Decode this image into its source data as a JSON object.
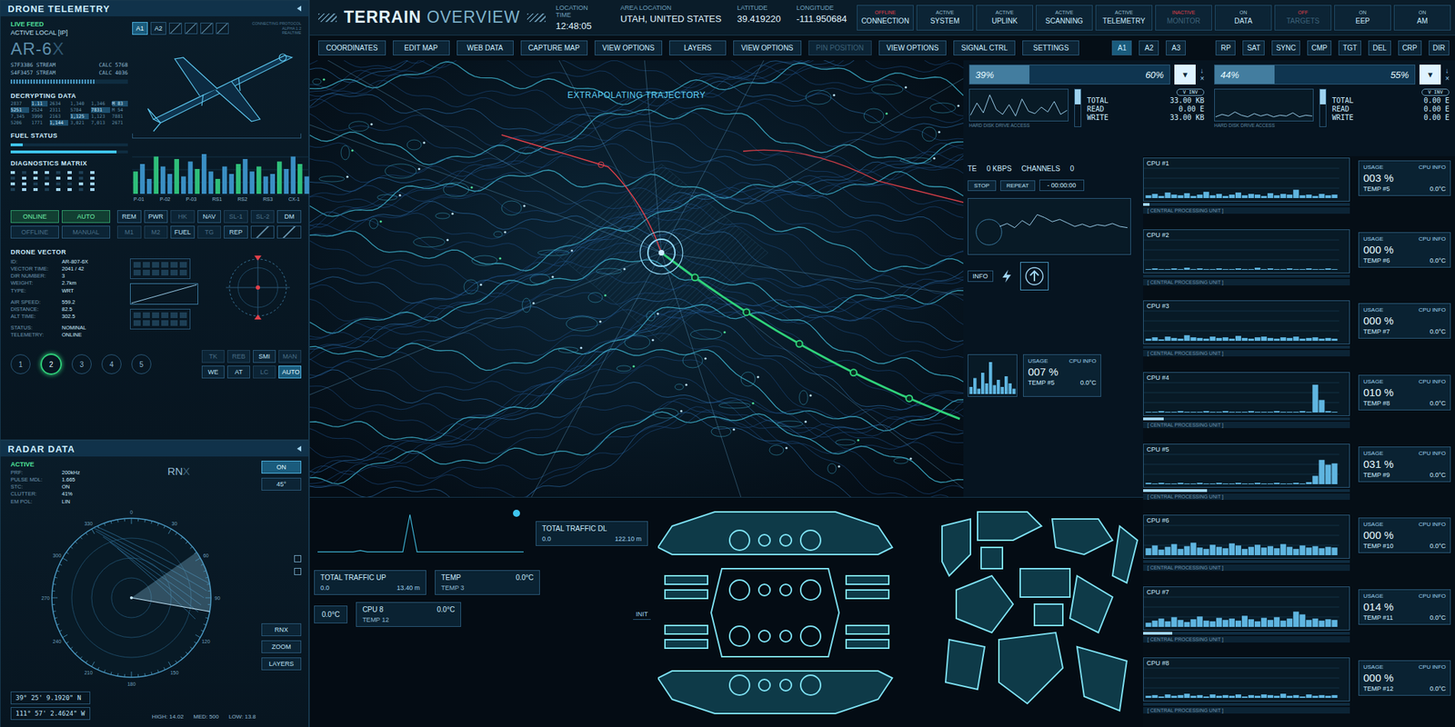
{
  "header": {
    "title_bold": "TERRAIN",
    "title_light": "OVERVIEW",
    "fields": [
      {
        "label": "LOCATION TIME",
        "value": "12:48:05"
      },
      {
        "label": "AREA LOCATION",
        "value": "UTAH, UNITED STATES"
      },
      {
        "label": "LATITUDE",
        "value": "39.419220"
      },
      {
        "label": "LONGITUDE",
        "value": "-111.950684"
      }
    ],
    "status": [
      {
        "state": "OFFLINE",
        "label": "CONNECTION",
        "on": false,
        "disabled": false
      },
      {
        "state": "ACTIVE",
        "label": "SYSTEM",
        "on": true,
        "disabled": false
      },
      {
        "state": "ACTIVE",
        "label": "UPLINK",
        "on": true,
        "disabled": false
      },
      {
        "state": "ACTIVE",
        "label": "SCANNING",
        "on": true,
        "disabled": false
      },
      {
        "state": "ACTIVE",
        "label": "TELEMETRY",
        "on": true,
        "disabled": false
      },
      {
        "state": "INACTIVE",
        "label": "MONITOR",
        "on": false,
        "disabled": true
      },
      {
        "state": "ON",
        "label": "DATA",
        "on": true,
        "disabled": false
      },
      {
        "state": "OFF",
        "label": "TARGETS",
        "on": false,
        "disabled": true
      },
      {
        "state": "ON",
        "label": "EEP",
        "on": true,
        "disabled": false
      },
      {
        "state": "ON",
        "label": "AM",
        "on": true,
        "disabled": false
      }
    ]
  },
  "toolbar": {
    "buttons": [
      {
        "label": "COORDINATES",
        "disabled": false
      },
      {
        "label": "EDIT MAP",
        "disabled": false
      },
      {
        "label": "WEB DATA",
        "disabled": false
      },
      {
        "label": "CAPTURE MAP",
        "disabled": false
      },
      {
        "label": "VIEW OPTIONS",
        "disabled": false
      },
      {
        "label": "LAYERS",
        "disabled": false
      },
      {
        "label": "VIEW OPTIONS",
        "disabled": false
      },
      {
        "label": "PIN POSITION",
        "disabled": true
      },
      {
        "label": "VIEW OPTIONS",
        "disabled": false
      },
      {
        "label": "SIGNAL CTRL",
        "disabled": false
      },
      {
        "label": "SETTINGS",
        "disabled": false
      }
    ],
    "tabs": [
      {
        "label": "A1",
        "selected": true
      },
      {
        "label": "A2",
        "selected": false
      },
      {
        "label": "A3",
        "selected": false
      }
    ],
    "tools": [
      "RP",
      "SAT",
      "SYNC",
      "CMP",
      "TGT",
      "DEL",
      "CRP",
      "DIR"
    ]
  },
  "telemetry": {
    "title": "DRONE TELEMETRY",
    "feed": "LIVE FEED",
    "source": "ACTIVE LOCAL [IP]",
    "model_bold": "AR-6",
    "model_light": "X",
    "protocol": [
      "CONNECTING PROTOCOL",
      "ALPHA 1.2",
      "REALTIME"
    ],
    "tabs": [
      {
        "label": "A1",
        "selected": true
      },
      {
        "label": "A2",
        "selected": false
      }
    ],
    "streams": [
      {
        "name": "S7F3386 STREAM",
        "calc": "CALC 5768"
      },
      {
        "name": "S4F3457 STREAM",
        "calc": "CALC 4036"
      }
    ],
    "stream_level": 0.72,
    "decrypt": {
      "title": "DECRYPTING DATA",
      "rows": [
        [
          "2837",
          "1.11",
          "2634",
          "1,340",
          "1,346",
          "M 83"
        ],
        [
          "5251",
          "2524",
          "2311",
          "5784",
          "7831",
          "M 54"
        ],
        [
          "7,345",
          "3990",
          "2163",
          "1,125",
          "1,123",
          "7881"
        ],
        [
          "5206",
          "1771",
          "1,144",
          "3,021",
          "7,013",
          "2671"
        ]
      ]
    },
    "fuel": {
      "title": "FUEL STATUS",
      "levels": [
        0.1,
        0.9
      ]
    },
    "diagnostics": {
      "title": "DIAGNOSTICS MATRIX",
      "cells": [
        true,
        false,
        true,
        true,
        false,
        true,
        false,
        true,
        false,
        true,
        true,
        false,
        true,
        true,
        false,
        true,
        true,
        true,
        false,
        true,
        false,
        false,
        true,
        true,
        false,
        true,
        true,
        false,
        true,
        true,
        false,
        true
      ],
      "labels": [
        "P-01",
        "P-02",
        "P-03",
        "RS1",
        "RS2",
        "RS3",
        "CX-1"
      ],
      "values": [
        45,
        60,
        30,
        75,
        55,
        40,
        70,
        35,
        65,
        50,
        80,
        45,
        30,
        55,
        40,
        60,
        70,
        45,
        55,
        35,
        40,
        65,
        50,
        75,
        60,
        35,
        45,
        55
      ]
    },
    "modes": [
      {
        "label": "ONLINE",
        "selected": true
      },
      {
        "label": "AUTO",
        "selected": true
      },
      {
        "label": "OFFLINE",
        "selected": false
      },
      {
        "label": "MANUAL",
        "selected": false
      }
    ],
    "keys": [
      {
        "label": "REM",
        "disabled": false
      },
      {
        "label": "PWR",
        "disabled": false
      },
      {
        "label": "HK",
        "disabled": true
      },
      {
        "label": "NAV",
        "disabled": false
      },
      {
        "label": "SL-1",
        "disabled": true
      },
      {
        "label": "SL-2",
        "disabled": true
      },
      {
        "label": "DM",
        "disabled": false
      },
      {
        "label": "M1",
        "disabled": true
      },
      {
        "label": "M2",
        "disabled": true
      },
      {
        "label": "FUEL",
        "disabled": false
      },
      {
        "label": "TG",
        "disabled": true
      },
      {
        "label": "REP",
        "disabled": false
      }
    ],
    "vector": {
      "title": "DRONE VECTOR",
      "groups": [
        [
          {
            "label": "ID:",
            "value": "AR-807-6X"
          },
          {
            "label": "VECTOR TIME:",
            "value": "2041 / 42"
          },
          {
            "label": "DIR NUMBER:",
            "value": "3"
          },
          {
            "label": "WEIGHT:",
            "value": "2.7km"
          },
          {
            "label": "TYPE:",
            "value": "WRT"
          }
        ],
        [
          {
            "label": "AIR SPEED:",
            "value": "559.2"
          },
          {
            "label": "DISTANCE:",
            "value": "82.5"
          },
          {
            "label": "ALT TIME:",
            "value": "302.5"
          }
        ],
        [
          {
            "label": "STATUS:",
            "value": "NOMINAL"
          },
          {
            "label": "TELEMETRY:",
            "value": "ONLINE"
          }
        ]
      ]
    },
    "slots": [
      {
        "label": "1",
        "selected": false
      },
      {
        "label": "2",
        "selected": true
      },
      {
        "label": "3",
        "selected": false
      },
      {
        "label": "4",
        "selected": false
      },
      {
        "label": "5",
        "selected": false
      }
    ],
    "switches": [
      {
        "label": "TK",
        "disabled": true,
        "selected": false
      },
      {
        "label": "REB",
        "disabled": true,
        "selected": false
      },
      {
        "label": "SMI",
        "disabled": false,
        "selected": false
      },
      {
        "label": "MAN",
        "disabled": true,
        "selected": false
      },
      {
        "label": "WE",
        "disabled": false,
        "selected": false
      },
      {
        "label": "AT",
        "disabled": false,
        "selected": false
      },
      {
        "label": "LC",
        "disabled": true,
        "selected": false
      },
      {
        "label": "AUTO",
        "disabled": false,
        "selected": true
      }
    ]
  },
  "radar": {
    "title": "RADAR DATA",
    "status": "ACTIVE",
    "name_bold": "RN",
    "name_light": "X",
    "toggle": "ON",
    "angle": "45°",
    "params": [
      {
        "label": "PRF:",
        "value": "200kHz"
      },
      {
        "label": "PULSE MDL:",
        "value": "1.665"
      },
      {
        "label": "STC:",
        "value": "ON"
      },
      {
        "label": "CLUTTER:",
        "value": "41%"
      },
      {
        "label": "EM POL:",
        "value": "LIN"
      }
    ],
    "bearings": [
      "0",
      "30",
      "60",
      "90",
      "120",
      "150",
      "180",
      "210",
      "240",
      "270",
      "300",
      "330"
    ],
    "coords": [
      "39° 25' 9.1920\" N",
      "111° 57' 2.4624\" W"
    ],
    "buttons": [
      "RNX",
      "ZOOM",
      "LAYERS"
    ],
    "readings": [
      {
        "label": "HIGH:",
        "value": "14.02"
      },
      {
        "label": "MED:",
        "value": "500"
      },
      {
        "label": "LOW:",
        "value": "13.8"
      }
    ]
  },
  "map": {
    "caption": "EXTRAPOLATING TRAJECTORY"
  },
  "disks": [
    {
      "low": "39%",
      "high": "60%",
      "level": 0.3,
      "arrow": "▼",
      "marks": [
        "↓",
        "×"
      ],
      "caption": "HARD DISK DRIVE ACCESS",
      "filter": "V INV",
      "stats": [
        {
          "label": "TOTAL",
          "value": "33.00 KB"
        },
        {
          "label": "READ",
          "value": "0.00 E"
        },
        {
          "label": "WRITE",
          "value": "33.00 KB"
        }
      ],
      "values": [
        5,
        20,
        8,
        30,
        12,
        6,
        18,
        4,
        25,
        10,
        7,
        15,
        9,
        22,
        6,
        11
      ]
    },
    {
      "low": "44%",
      "high": "55%",
      "level": 0.3,
      "arrow": "▼",
      "marks": [
        "↓",
        "×"
      ],
      "caption": "HARD DISK DRIVE ACCESS",
      "filter": "V INV",
      "stats": [
        {
          "label": "TOTAL",
          "value": "0.00 E"
        },
        {
          "label": "READ",
          "value": "0.00 E"
        },
        {
          "label": "WRITE",
          "value": "0.00 E"
        }
      ],
      "values": [
        3,
        6,
        4,
        9,
        5,
        3,
        7,
        4,
        6,
        3,
        5,
        4,
        8,
        3,
        5,
        4
      ]
    }
  ],
  "monitor": {
    "rate_label": "TE",
    "rate": "0 KBPS",
    "channels_label": "CHANNELS",
    "channels": "0",
    "controls": [
      "STOP",
      "REPEAT"
    ],
    "timer": "- 00:00:00",
    "info": "INFO",
    "values": [
      30,
      35,
      28,
      40,
      32,
      50,
      45,
      38,
      42,
      36,
      30,
      34,
      29,
      33,
      31,
      35,
      30,
      28
    ],
    "usage": {
      "label": "USAGE",
      "tag": "CPU INFO",
      "value": "007 %",
      "temp": "TEMP #5",
      "temp_value": "0.0°C",
      "values": [
        4,
        9,
        3,
        12,
        6,
        18,
        5,
        8,
        4,
        10,
        6,
        3
      ]
    }
  },
  "cpu_labels": {
    "usage": "USAGE",
    "tag": "CPU INFO"
  },
  "cpus": [
    {
      "name": "CPU #1",
      "caption": "[ CENTRAL PROCESSING UNIT ]",
      "usage": "003 %",
      "temp": "TEMP #5",
      "temp_value": "0.0°C",
      "level": 0.03,
      "values": [
        4,
        6,
        3,
        8,
        5,
        4,
        7,
        3,
        5,
        9,
        4,
        6,
        3,
        5,
        8,
        4,
        6,
        5,
        3,
        7,
        4,
        6,
        5,
        12,
        4,
        5,
        3,
        6,
        4,
        5
      ]
    },
    {
      "name": "CPU #2",
      "caption": "[ CENTRAL PROCESSING UNIT ]",
      "usage": "000 %",
      "temp": "TEMP #6",
      "temp_value": "0.0°C",
      "level": 0.0,
      "values": [
        1,
        2,
        1,
        1,
        2,
        1,
        3,
        1,
        2,
        1,
        1,
        2,
        1,
        1,
        2,
        1,
        1,
        3,
        1,
        2,
        1,
        1,
        2,
        1,
        1,
        2,
        1,
        1,
        2,
        1
      ]
    },
    {
      "name": "CPU #3",
      "caption": "[ CENTRAL PROCESSING UNIT ]",
      "usage": "000 %",
      "temp": "TEMP #7",
      "temp_value": "0.0°C",
      "level": 0.0,
      "values": [
        3,
        5,
        2,
        6,
        4,
        3,
        8,
        5,
        4,
        3,
        6,
        4,
        5,
        3,
        7,
        4,
        3,
        5,
        6,
        4,
        3,
        5,
        4,
        6,
        3,
        4,
        5,
        3,
        4,
        3
      ]
    },
    {
      "name": "CPU #4",
      "caption": "[ CENTRAL PROCESSING UNIT ]",
      "usage": "010 %",
      "temp": "TEMP #8",
      "temp_value": "0.0°C",
      "level": 0.1,
      "values": [
        1,
        1,
        2,
        1,
        1,
        2,
        1,
        1,
        1,
        2,
        1,
        1,
        2,
        1,
        1,
        1,
        2,
        1,
        1,
        1,
        2,
        1,
        1,
        1,
        2,
        1,
        40,
        18,
        2,
        1
      ]
    },
    {
      "name": "CPU #5",
      "caption": "[ CENTRAL PROCESSING UNIT ]",
      "usage": "031 %",
      "temp": "TEMP #9",
      "temp_value": "0.0°C",
      "level": 0.31,
      "values": [
        2,
        1,
        2,
        1,
        1,
        2,
        1,
        1,
        2,
        1,
        1,
        2,
        1,
        1,
        2,
        1,
        1,
        2,
        1,
        1,
        2,
        1,
        1,
        2,
        1,
        3,
        12,
        35,
        28,
        30
      ]
    },
    {
      "name": "CPU #6",
      "caption": "[ CENTRAL PROCESSING UNIT ]",
      "usage": "000 %",
      "temp": "TEMP #10",
      "temp_value": "0.0°C",
      "level": 0.0,
      "values": [
        10,
        14,
        8,
        12,
        16,
        9,
        13,
        18,
        11,
        9,
        15,
        12,
        10,
        17,
        14,
        9,
        12,
        15,
        11,
        13,
        10,
        16,
        12,
        9,
        14,
        11,
        13,
        10,
        12,
        11
      ]
    },
    {
      "name": "CPU #7",
      "caption": "[ CENTRAL PROCESSING UNIT ]",
      "usage": "014 %",
      "temp": "TEMP #11",
      "temp_value": "0.0°C",
      "level": 0.14,
      "values": [
        6,
        9,
        12,
        8,
        14,
        10,
        7,
        11,
        15,
        9,
        8,
        13,
        10,
        12,
        9,
        16,
        11,
        8,
        13,
        10,
        14,
        9,
        12,
        22,
        18,
        10,
        12,
        9,
        11,
        10
      ]
    },
    {
      "name": "CPU #8",
      "caption": "[ CENTRAL PROCESSING UNIT ]",
      "usage": "000 %",
      "temp": "TEMP #12",
      "temp_value": "0.0°C",
      "level": 0.0,
      "values": [
        3,
        4,
        2,
        5,
        3,
        4,
        6,
        3,
        4,
        2,
        5,
        3,
        4,
        3,
        5,
        2,
        4,
        3,
        5,
        4,
        3,
        6,
        3,
        4,
        2,
        5,
        3,
        4,
        3,
        4
      ]
    }
  ],
  "bottom": {
    "traffic": [
      {
        "title": "TOTAL TRAFFIC DL",
        "low": "0.0",
        "value": "122.10 m"
      },
      {
        "title": "TOTAL TRAFFIC UP",
        "low": "0.0",
        "value": "13.40 m"
      }
    ],
    "values": [
      2,
      2,
      2,
      2,
      2,
      2,
      3,
      2,
      2,
      2,
      2,
      2,
      2,
      30,
      2,
      2,
      2,
      2,
      2,
      2,
      2,
      2,
      2,
      2,
      2,
      2,
      2,
      2,
      2,
      2
    ],
    "cards": [
      {
        "title": "TEMP",
        "value": "0.0°C",
        "sub": "TEMP 3"
      },
      {
        "title": "CPU 8",
        "value": "0.0°C",
        "sub": "TEMP 12"
      }
    ],
    "standalone": "0.0°C",
    "init": "INIT"
  }
}
